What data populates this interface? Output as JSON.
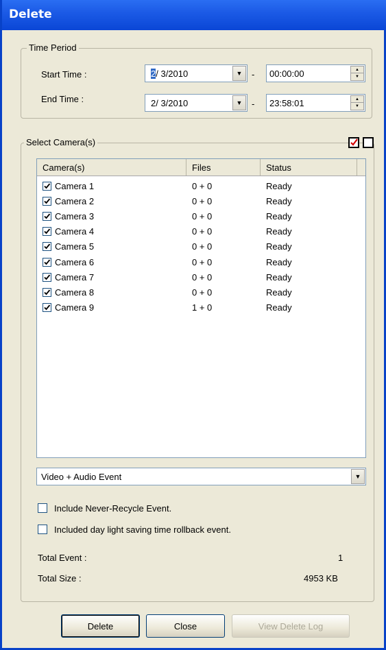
{
  "window": {
    "title": "Delete"
  },
  "time_period": {
    "label": "Time Period",
    "start_label": "Start Time :",
    "end_label": "End Time :",
    "start_date_sel": "2",
    "start_date_rest": "/ 3/2010",
    "start_time": "00:00:00",
    "end_date": "2/ 3/2010",
    "end_time": "23:58:01",
    "dash": "-"
  },
  "cameras": {
    "label": "Select Camera(s)",
    "columns": [
      "Camera(s)",
      "Files",
      "Status"
    ],
    "rows": [
      {
        "name": "Camera 1",
        "files": "0 + 0",
        "status": "Ready",
        "checked": true
      },
      {
        "name": "Camera 2",
        "files": "0 + 0",
        "status": "Ready",
        "checked": true
      },
      {
        "name": "Camera 3",
        "files": "0 + 0",
        "status": "Ready",
        "checked": true
      },
      {
        "name": "Camera 4",
        "files": "0 + 0",
        "status": "Ready",
        "checked": true
      },
      {
        "name": "Camera 5",
        "files": "0 + 0",
        "status": "Ready",
        "checked": true
      },
      {
        "name": "Camera 6",
        "files": "0 + 0",
        "status": "Ready",
        "checked": true
      },
      {
        "name": "Camera 7",
        "files": "0 + 0",
        "status": "Ready",
        "checked": true
      },
      {
        "name": "Camera 8",
        "files": "0 + 0",
        "status": "Ready",
        "checked": true
      },
      {
        "name": "Camera 9",
        "files": "1 + 0",
        "status": "Ready",
        "checked": true
      }
    ]
  },
  "event_type": {
    "selected": "Video + Audio Event"
  },
  "options": {
    "never_recycle": "Include Never-Recycle Event.",
    "dst_rollback": "Included day light saving time rollback event."
  },
  "totals": {
    "event_label": "Total Event :",
    "event_value": "1",
    "size_label": "Total Size :",
    "size_value": "4953 KB"
  },
  "buttons": {
    "delete": "Delete",
    "close": "Close",
    "view_log": "View Delete Log"
  },
  "colors": {
    "title_bar": "#0a46d6",
    "check_all_icon": "#d40000"
  }
}
